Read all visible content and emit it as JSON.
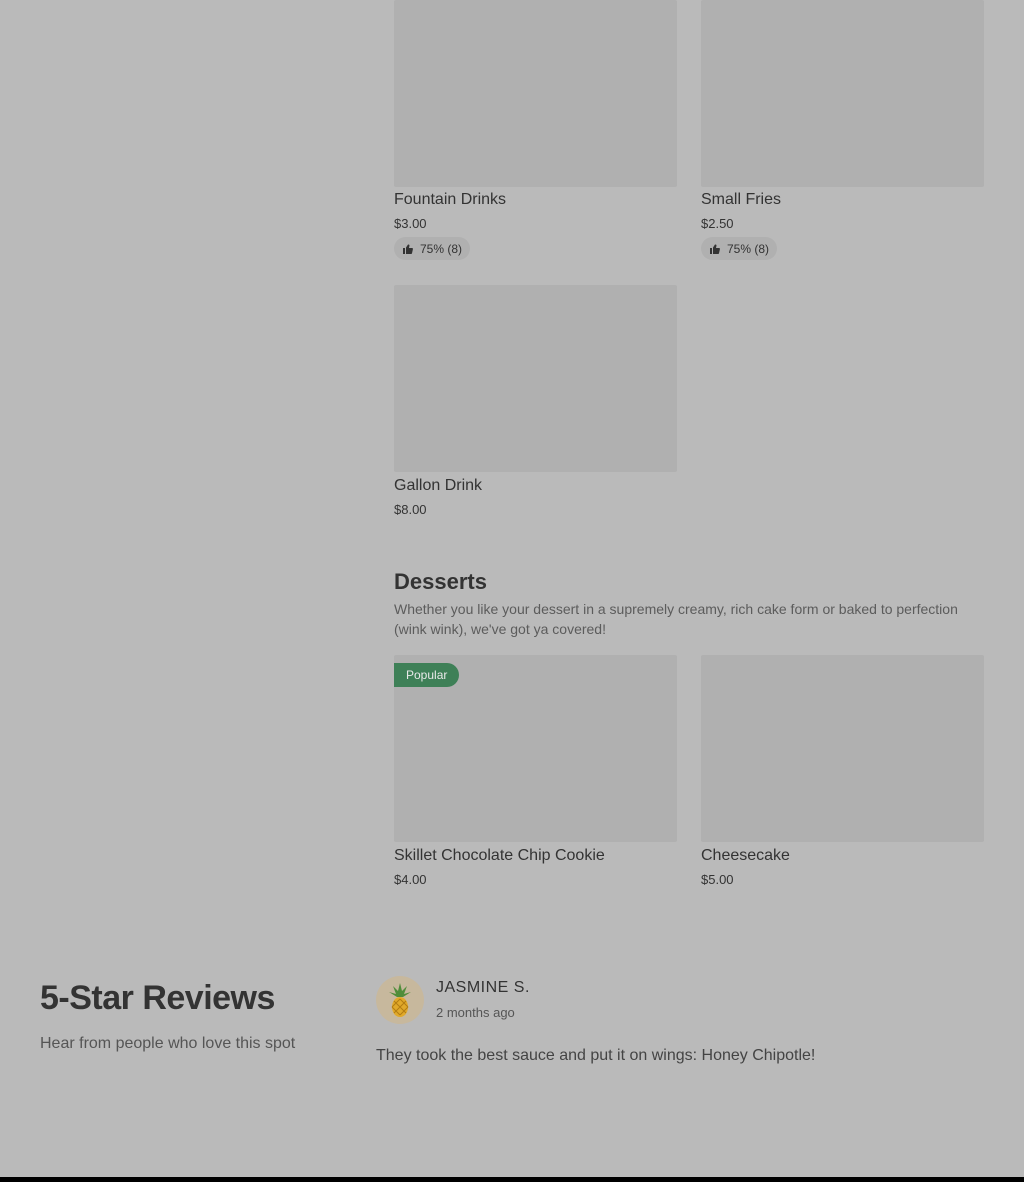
{
  "drinks": {
    "items": [
      {
        "title": "Fountain Drinks",
        "price": "$3.00",
        "rating": "75% (8)"
      },
      {
        "title": "Small Fries",
        "price": "$2.50",
        "rating": "75% (8)"
      },
      {
        "title": "Gallon Drink",
        "price": "$8.00"
      }
    ]
  },
  "desserts": {
    "title": "Desserts",
    "description": "Whether you like your dessert in a supremely creamy, rich cake form or baked to perfection (wink wink), we've got ya covered!",
    "badge": "Popular",
    "items": [
      {
        "title": "Skillet Chocolate Chip Cookie",
        "price": "$4.00"
      },
      {
        "title": "Cheesecake",
        "price": "$5.00"
      }
    ]
  },
  "reviews": {
    "title": "5-Star Reviews",
    "subtitle": "Hear from people who love this spot",
    "items": [
      {
        "name": "JASMINE S.",
        "date": "2 months ago",
        "text": "They took the best sauce and put it on wings: Honey Chipotle!",
        "avatar_icon": "pineapple-icon"
      }
    ]
  },
  "colors": {
    "background": "#bababa",
    "image_placeholder": "#b0b0b0",
    "badge": "#3e8057"
  }
}
